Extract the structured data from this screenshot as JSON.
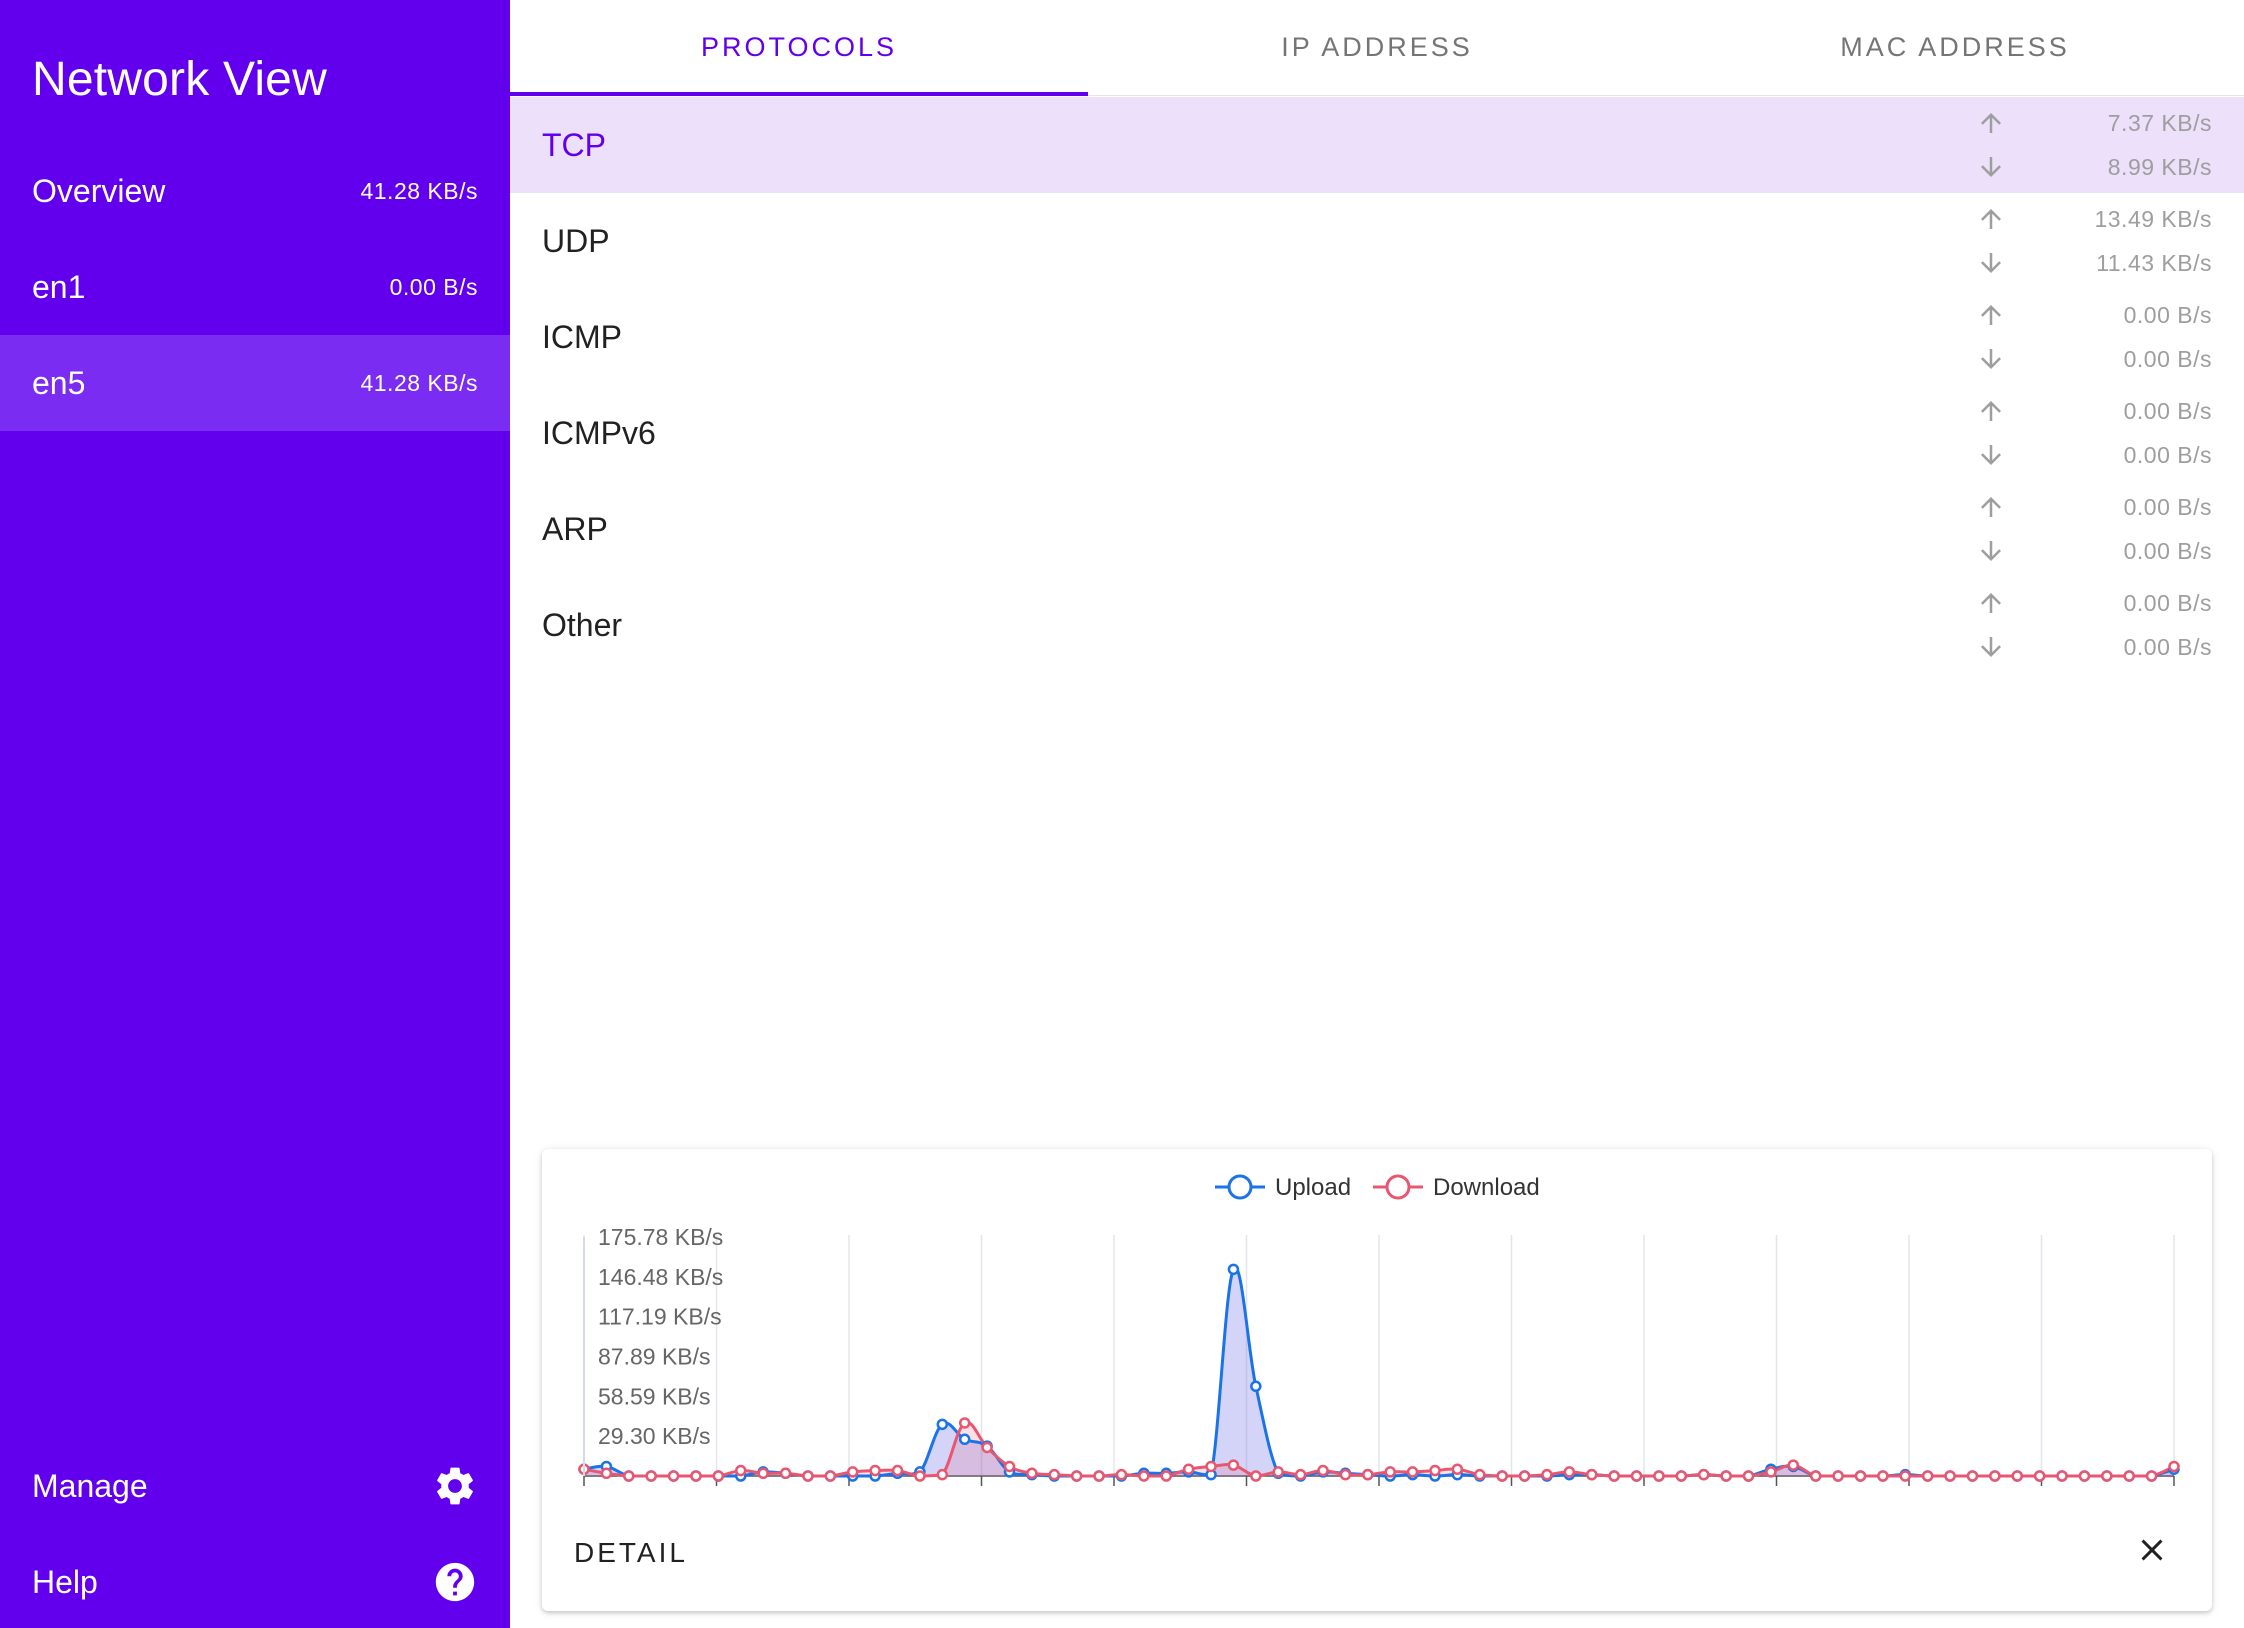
{
  "app": {
    "title": "Network View"
  },
  "sidebar": {
    "items": [
      {
        "label": "Overview",
        "rate": "41.28 KB/s"
      },
      {
        "label": "en1",
        "rate": "0.00 B/s"
      },
      {
        "label": "en5",
        "rate": "41.28 KB/s",
        "selected": true
      }
    ],
    "manage_label": "Manage",
    "help_label": "Help"
  },
  "tabs": [
    {
      "label": "PROTOCOLS",
      "active": true
    },
    {
      "label": "IP ADDRESS"
    },
    {
      "label": "MAC ADDRESS"
    }
  ],
  "protocols": [
    {
      "name": "TCP",
      "up": "7.37 KB/s",
      "down": "8.99 KB/s",
      "selected": true
    },
    {
      "name": "UDP",
      "up": "13.49 KB/s",
      "down": "11.43 KB/s"
    },
    {
      "name": "ICMP",
      "up": "0.00 B/s",
      "down": "0.00 B/s"
    },
    {
      "name": "ICMPv6",
      "up": "0.00 B/s",
      "down": "0.00 B/s"
    },
    {
      "name": "ARP",
      "up": "0.00 B/s",
      "down": "0.00 B/s"
    },
    {
      "name": "Other",
      "up": "0.00 B/s",
      "down": "0.00 B/s"
    }
  ],
  "detail": {
    "label": "DETAIL"
  },
  "colors": {
    "primary": "#6200ee",
    "upload": "#1a73e8",
    "download": "#e8576f"
  },
  "chart_data": {
    "type": "area",
    "legend_position": "top-center",
    "grid": true,
    "y_tick_labels": [
      "175.78 KB/s",
      "146.48 KB/s",
      "117.19 KB/s",
      "87.89 KB/s",
      "58.59 KB/s",
      "29.30 KB/s"
    ],
    "y_ticks": [
      175.78,
      146.48,
      117.19,
      87.89,
      58.59,
      29.3
    ],
    "ylim": [
      0,
      175.78
    ],
    "y_unit": "KB/s",
    "series": [
      {
        "name": "Upload",
        "color": "#1a73e8",
        "values": [
          5,
          7,
          0,
          0,
          0,
          0,
          0,
          0,
          3,
          2,
          0,
          0,
          0,
          0,
          2,
          3,
          38,
          27,
          22,
          3,
          1,
          0,
          0,
          0,
          0,
          2,
          2,
          3,
          1,
          152,
          66,
          2,
          0,
          3,
          2,
          1,
          0,
          1,
          0,
          1,
          0,
          0,
          0,
          0,
          1,
          1,
          0,
          0,
          0,
          0,
          1,
          0,
          0,
          5,
          7,
          0,
          0,
          0,
          0,
          1,
          0,
          0,
          0,
          0,
          0,
          0,
          0,
          0,
          0,
          0,
          0,
          5
        ]
      },
      {
        "name": "Download",
        "color": "#e8576f",
        "values": [
          5,
          2,
          0,
          0,
          0,
          0,
          0,
          4,
          2,
          2,
          0,
          0,
          3,
          4,
          4,
          0,
          1,
          39,
          21,
          7,
          2,
          1,
          0,
          0,
          1,
          0,
          0,
          5,
          7,
          8,
          0,
          3,
          1,
          4,
          1,
          1,
          3,
          3,
          4,
          5,
          1,
          0,
          0,
          1,
          3,
          1,
          0,
          0,
          0,
          0,
          1,
          0,
          0,
          3,
          8,
          0,
          0,
          0,
          0,
          0,
          0,
          0,
          0,
          0,
          0,
          0,
          0,
          0,
          0,
          0,
          0,
          7
        ]
      }
    ]
  }
}
